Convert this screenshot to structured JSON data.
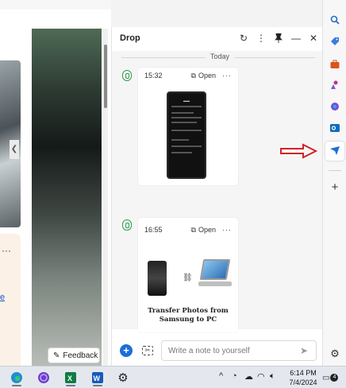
{
  "browser": {
    "feedback_label": "Feedback"
  },
  "drop": {
    "title": "Drop",
    "day_separator": "Today",
    "messages": [
      {
        "time": "15:32",
        "open_label": "Open",
        "more": "···",
        "kind": "screenshot"
      },
      {
        "time": "16:55",
        "open_label": "Open",
        "more": "···",
        "kind": "image",
        "caption_line1": "Transfer Photos from",
        "caption_line2": "Samsung to PC"
      }
    ],
    "note_placeholder": "Write a note to yourself"
  },
  "sidebar": {
    "icons": [
      "search-icon",
      "tag-icon",
      "briefcase-icon",
      "games-icon",
      "copilot-icon",
      "outlook-icon",
      "drop-icon",
      "add-icon",
      "settings-icon"
    ],
    "active": "drop-icon"
  },
  "taskbar": {
    "apps": [
      "edge-icon",
      "app-circle-icon",
      "excel-icon",
      "word-icon",
      "settings-icon"
    ],
    "time": "6:14 PM",
    "date": "7/4/2024",
    "notification_count": "4"
  },
  "colors": {
    "accent": "#1a6fd6",
    "status_green": "#2e9e4d",
    "annotation_red": "#d3232a"
  }
}
